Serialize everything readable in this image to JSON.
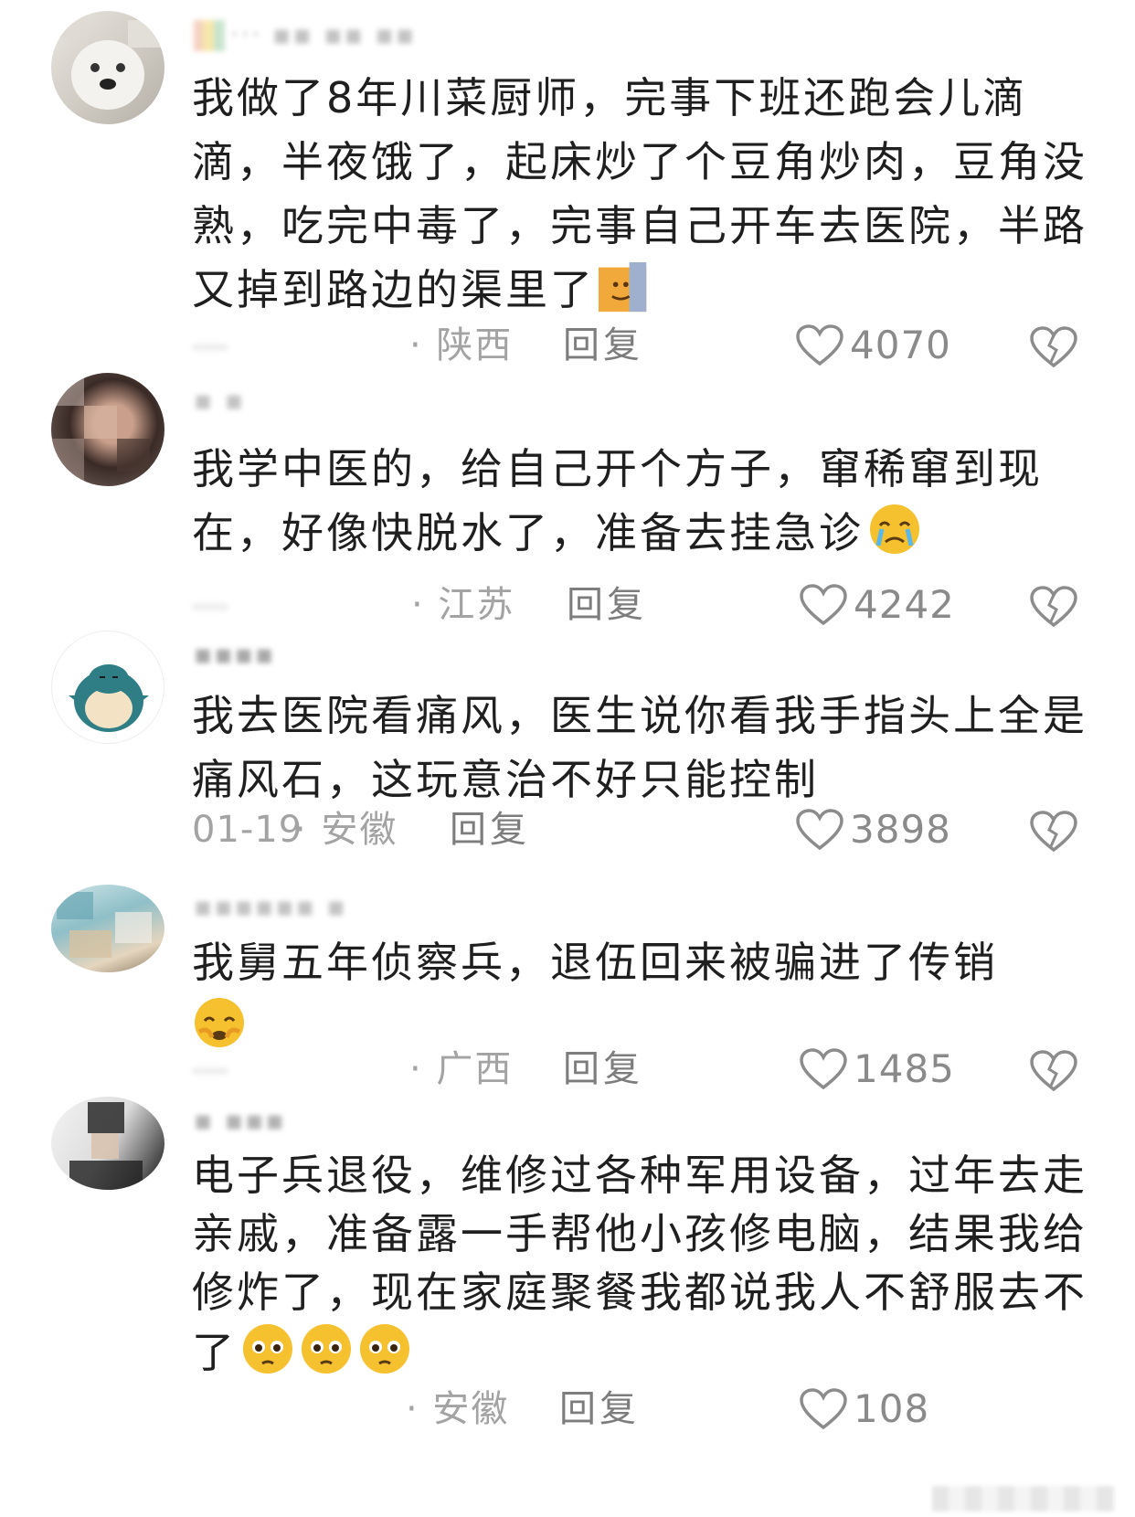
{
  "comments": [
    {
      "username": "‧‧‧ ▪▪ ▪▪ ▪▪",
      "text": "我做了8年川菜厨师，完事下班还跑会儿滴滴，半夜饿了，起床炒了个豆角炒肉，豆角没熟，吃完中毒了，完事自己开车去医院，半路又掉到路边的渠里了",
      "emoji": "cat-face-icon",
      "date": "",
      "region": "· 陕西",
      "reply": "回复",
      "likes": "4070"
    },
    {
      "username": "▪ ▪",
      "text": "我学中医的，给自己开个方子，窜稀窜到现在，好像快脱水了，准备去挂急诊",
      "emoji": "crying-face-icon",
      "date": "",
      "region": "· 江苏",
      "reply": "回复",
      "likes": "4242"
    },
    {
      "username": "▪▪▪▪",
      "text": "我去医院看痛风，医生说你看我手指头上全是痛风石，这玩意治不好只能控制",
      "emoji": "",
      "date": "01-19",
      "region": "· 安徽",
      "reply": "回复",
      "likes": "3898"
    },
    {
      "username": "▪▪▪▪▪▪ ▪",
      "text": "我舅五年侦察兵，退伍回来被骗进了传销",
      "emoji": "crying-face-icon",
      "date": "",
      "region": "· 广西",
      "reply": "回复",
      "likes": "1485"
    },
    {
      "username": "▪ ▪▪▪",
      "text": "电子兵退役，维修过各种军用设备，过年去走亲戚，准备露一手帮他小孩修电脑，结果我给修炸了，现在家庭聚餐我都说我人不舒服去不了",
      "emoji": "pleading-face-icon",
      "date": "",
      "region": "· 安徽",
      "reply": "回复",
      "likes": "108"
    }
  ],
  "colors": {
    "text": "#1f1f1f",
    "meta": "#a3a3a3",
    "reply": "#7d7d7d",
    "emoji_yellow": "#f6c12f"
  }
}
